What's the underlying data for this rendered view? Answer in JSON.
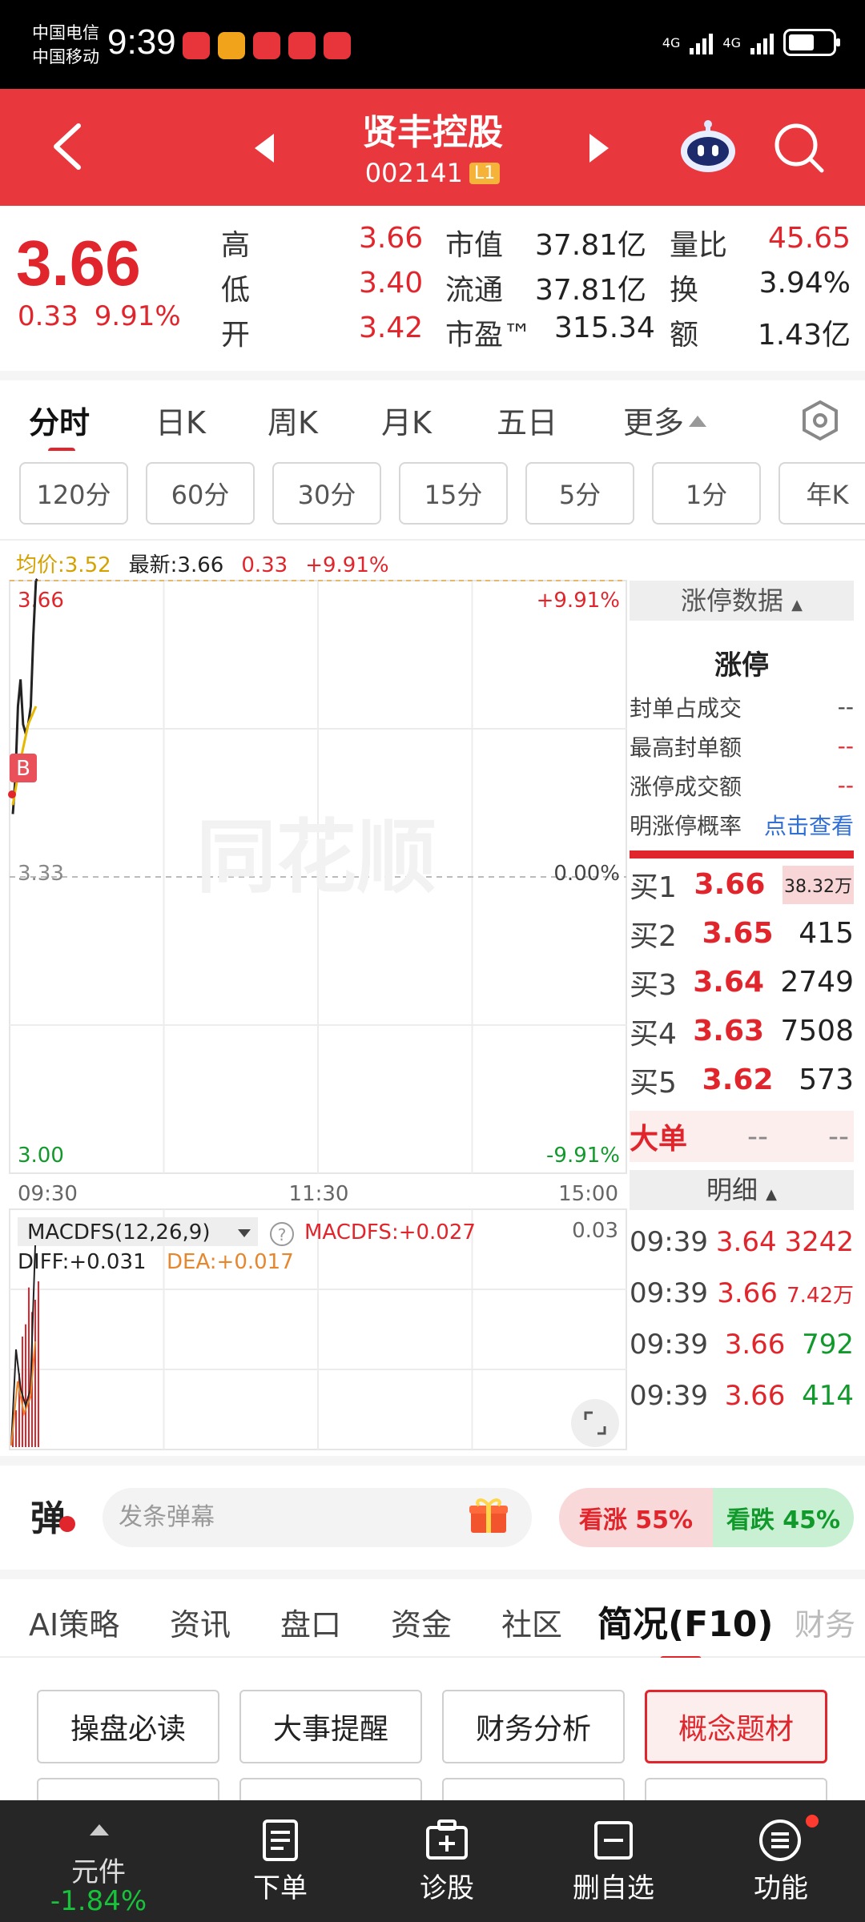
{
  "status": {
    "carrier1": "中国电信",
    "carrier2": "中国移动",
    "time": "9:39",
    "net1": "4G",
    "net2": "4G"
  },
  "header": {
    "title": "贤丰控股",
    "code": "002141",
    "level": "L1"
  },
  "quote": {
    "price": "3.66",
    "change": "0.33",
    "pct": "9.91%",
    "high_label": "高",
    "high": "3.66",
    "low_label": "低",
    "low": "3.40",
    "open_label": "开",
    "open": "3.42",
    "mcap_label": "市值",
    "mcap": "37.81亿",
    "float_label": "流通",
    "float": "37.81亿",
    "pe_label": "市盈™",
    "pe": "315.34",
    "vr_label": "量比",
    "vr": "45.65",
    "turn_label": "换",
    "turn": "3.94%",
    "amt_label": "额",
    "amt": "1.43亿"
  },
  "tabs": [
    "分时",
    "日K",
    "周K",
    "月K",
    "五日",
    "更多"
  ],
  "periods": [
    "120分",
    "60分",
    "30分",
    "15分",
    "5分",
    "1分",
    "年K"
  ],
  "chart_data": {
    "type": "line",
    "legend": {
      "avg": "均价:3.52",
      "latest": "最新:3.66",
      "chg": "0.33",
      "pct": "+9.91%"
    },
    "y_labels": {
      "top": "3.66",
      "mid": "3.33",
      "bottom": "3.00"
    },
    "pct_labels": {
      "top": "+9.91%",
      "mid": "0.00%",
      "bottom": "-9.91%"
    },
    "x_labels": [
      "09:30",
      "11:30",
      "15:00"
    ],
    "ylim": [
      3.0,
      3.66
    ],
    "base": 3.33,
    "price_series": {
      "t": [
        0,
        1,
        2,
        3,
        4,
        5,
        6,
        7,
        8,
        9
      ],
      "values": [
        3.4,
        3.44,
        3.52,
        3.55,
        3.5,
        3.49,
        3.5,
        3.52,
        3.6,
        3.66
      ]
    },
    "avg_series": {
      "t": [
        0,
        3,
        6,
        9
      ],
      "values": [
        3.41,
        3.46,
        3.5,
        3.52
      ]
    },
    "session_minutes": 240,
    "marker": "B",
    "watermark": "同花顺",
    "macd": {
      "selector": "MACDFS(12,26,9)",
      "macdfs": "MACDFS:+0.027",
      "diff": "DIFF:+0.031",
      "dea": "DEA:+0.017",
      "ymax_label": "0.03",
      "bars": [
        0.004,
        0.006,
        0.012,
        0.018,
        0.02,
        0.026,
        0.022,
        0.024,
        0.027
      ]
    }
  },
  "side": {
    "head": "涨停数据",
    "title": "涨停",
    "rows": [
      {
        "label": "封单占成交",
        "value": "--"
      },
      {
        "label": "最高封单额",
        "value": "--"
      },
      {
        "label": "涨停成交额",
        "value": "--"
      },
      {
        "label": "明涨停概率",
        "value": "点击查看"
      }
    ],
    "bids": [
      {
        "label": "买1",
        "price": "3.66",
        "vol": "38.32万"
      },
      {
        "label": "买2",
        "price": "3.65",
        "vol": "415"
      },
      {
        "label": "买3",
        "price": "3.64",
        "vol": "2749"
      },
      {
        "label": "买4",
        "price": "3.63",
        "vol": "7508"
      },
      {
        "label": "买5",
        "price": "3.62",
        "vol": "573"
      }
    ],
    "bigorder": {
      "label": "大单",
      "v1": "--",
      "v2": "--"
    },
    "detail_head": "明细",
    "trades": [
      {
        "time": "09:39",
        "price": "3.64",
        "vol": "3242",
        "color": "#e0262c"
      },
      {
        "time": "09:39",
        "price": "3.66",
        "vol": "7.42万",
        "color": "#e0262c"
      },
      {
        "time": "09:39",
        "price": "3.66",
        "vol": "792",
        "color": "#119a2b"
      },
      {
        "time": "09:39",
        "price": "3.66",
        "vol": "414",
        "color": "#119a2b"
      }
    ]
  },
  "danmu": {
    "icon": "弹",
    "placeholder": "发条弹幕",
    "up": "看涨 55%",
    "down": "看跌 45%"
  },
  "btabs": [
    "AI策略",
    "资讯",
    "盘口",
    "资金",
    "社区",
    "简况(F10)",
    "财务"
  ],
  "f10": [
    "操盘必读",
    "大事提醒",
    "财务分析",
    "概念题材"
  ],
  "nav": {
    "element_label": "元件",
    "element_value": "-1.84%",
    "items": [
      "下单",
      "诊股",
      "删自选",
      "功能"
    ]
  }
}
